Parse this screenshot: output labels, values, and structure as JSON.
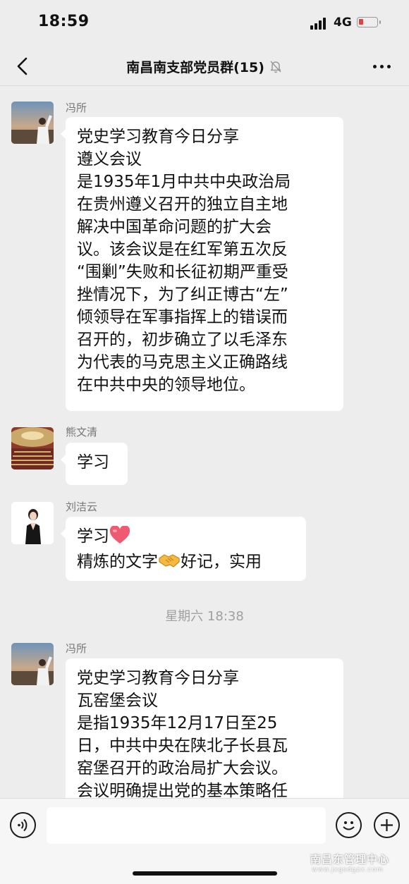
{
  "status_bar": {
    "time": "18:59",
    "network": "4G"
  },
  "chat": {
    "title": "南昌南支部党员群(15)"
  },
  "messages": [
    {
      "sender": "冯所",
      "lines": [
        "党史学习教育今日分享",
        "遵义会议",
        "是1935年1月中共中央政治局",
        "在贵州遵义召开的独立自主地",
        "解决中国革命问题的扩大会",
        "议。该会议是在红军第五次反",
        "“围剿”失败和长征初期严重受",
        "挫情况下，为了纠正博古“左”",
        "倾领导在军事指挥上的错误而",
        "召开的，初步确立了以毛泽东",
        "为代表的马克思主义正确路线",
        "在中共中央的领导地位。"
      ]
    },
    {
      "sender": "熊文清",
      "text": "学习"
    },
    {
      "sender": "刘洁云",
      "line1": "学习",
      "line2_before": "精炼的文字",
      "line2_after": "好记，实用"
    },
    {
      "sender": "冯所",
      "lines": [
        "党史学习教育今日分享",
        "瓦窑堡会议",
        "是指1935年12月17日至25",
        "日，中共中央在陕北子长县瓦",
        "窑堡召开的政治局扩大会议。",
        "会议明确提出党的基本策略任"
      ]
    }
  ],
  "timestamp": "星期六 18:38",
  "watermark": {
    "name": "南昌东管理中心",
    "url": "www.jxgsdgzx.com"
  },
  "icons": {
    "back": "chevron-left-icon",
    "mute": "bell-off-icon",
    "more": "more-dots-icon",
    "voice": "voice-icon",
    "emoji": "emoji-icon",
    "plus": "plus-icon"
  },
  "colors": {
    "background": "#ededed",
    "bubble": "#ffffff",
    "battery_low": "#e8413b"
  }
}
